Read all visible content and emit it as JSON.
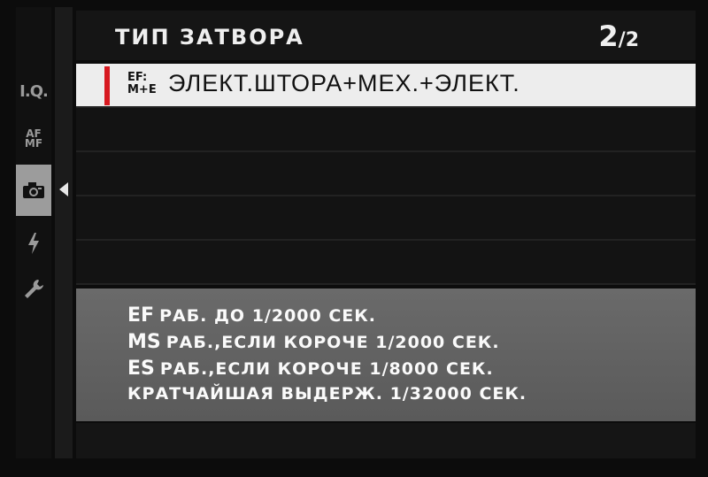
{
  "header": {
    "title": "ТИП ЗАТВОРА",
    "page_current": "2",
    "page_total": "/2"
  },
  "tabs": [
    {
      "name": "iq",
      "label": "I.Q."
    },
    {
      "name": "af-mf",
      "label_top": "AF",
      "label_bottom": "MF"
    },
    {
      "name": "shooting",
      "icon": "camera-icon",
      "selected": true
    },
    {
      "name": "flash",
      "icon": "flash-icon"
    },
    {
      "name": "setup",
      "icon": "wrench-icon"
    }
  ],
  "menu": {
    "selected_item": {
      "icon_top": "EF:",
      "icon_bottom": "M+E",
      "label": "ЭЛЕКТ.ШТОРА+МЕХ.+ЭЛЕКТ."
    }
  },
  "description": {
    "lines": [
      {
        "abbr": "EF",
        "text": "РАБ. ДО 1/2000 СЕК."
      },
      {
        "abbr": "MS",
        "text": "РАБ.,ЕСЛИ КОРОЧЕ 1/2000 СЕК."
      },
      {
        "abbr": "ES",
        "text": "РАБ.,ЕСЛИ КОРОЧЕ 1/8000 СЕК."
      },
      {
        "abbr": "",
        "text": "КРАТЧАЙШАЯ ВЫДЕРЖ. 1/32000 СЕК."
      }
    ]
  },
  "colors": {
    "accent_marker": "#d71920",
    "selected_row_bg": "#ededed",
    "description_bg": "#636363"
  }
}
